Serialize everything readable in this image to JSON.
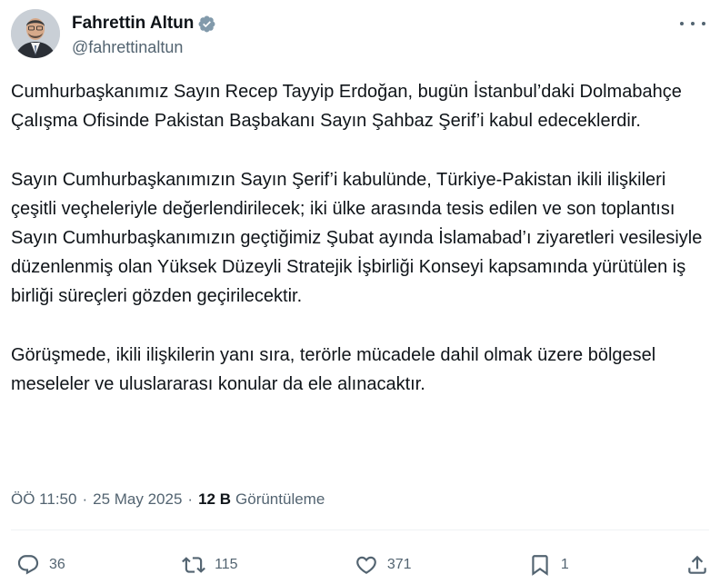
{
  "author": {
    "display_name": "Fahrettin Altun",
    "handle": "@fahrettinaltun",
    "verified_icon": "verified-badge-icon"
  },
  "post": {
    "paragraphs": [
      "Cumhurbaşkanımız Sayın Recep Tayyip Erdoğan, bugün İstanbul’daki Dolmabahçe Çalışma Ofisinde Pakistan Başbakanı Sayın Şahbaz Şerif’i kabul edeceklerdir.",
      "Sayın Cumhurbaşkanımızın Sayın Şerif’i kabulünde, Türkiye-Pakistan ikili ilişkileri çeşitli veçheleriyle değerlendirilecek; iki ülke arasında tesis edilen ve son toplantısı Sayın Cumhurbaşkanımızın geçtiğimiz Şubat ayında İslamabad’ı ziyaretleri vesilesiyle düzenlenmiş olan Yüksek Düzeyli Stratejik İşbirliği Konseyi kapsamında yürütülen iş birliği süreçleri gözden geçirilecektir.",
      "Görüşmede, ikili ilişkilerin yanı sıra, terörle mücadele dahil olmak üzere bölgesel meseleler ve uluslararası konular da ele alınacaktır."
    ]
  },
  "meta": {
    "time": "ÖÖ 11:50",
    "separator": "·",
    "date": "25 May 2025",
    "views_count": "12 B",
    "views_label": "Görüntüleme"
  },
  "actions": {
    "replies": "36",
    "reposts": "115",
    "likes": "371",
    "bookmarks": "1"
  },
  "colors": {
    "text": "#0f1419",
    "secondary": "#536471",
    "verified": "#829aab",
    "divider": "#eff3f4"
  }
}
